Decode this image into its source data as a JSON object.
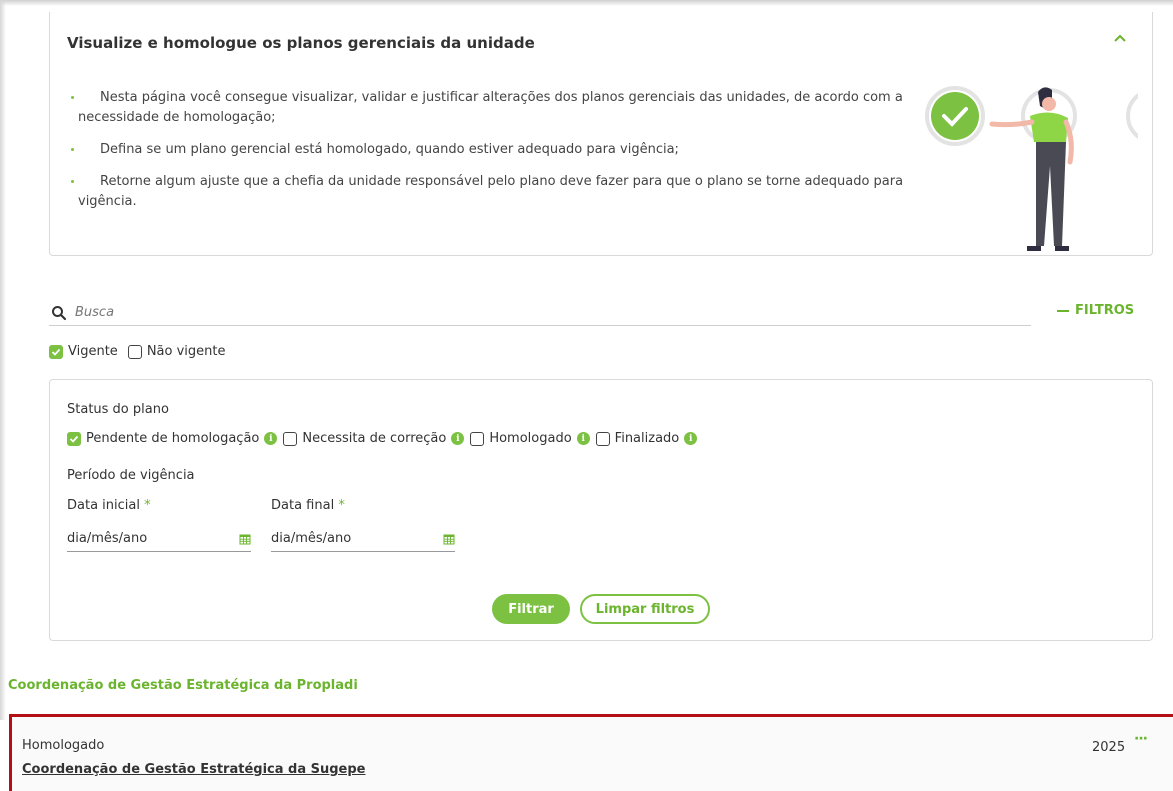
{
  "info": {
    "title": "Visualize e homologue os planos gerenciais da unidade",
    "items": [
      "Nesta página você consegue visualizar, validar e justificar alterações dos planos gerenciais das unidades, de acordo com a necessidade de homologação;",
      "Defina se um plano gerencial está homologado, quando estiver adequado para vigência;",
      "Retorne algum ajuste que a chefia da unidade responsável pelo plano deve fazer para que o plano se torne adequado para vigência."
    ]
  },
  "search": {
    "placeholder": "Busca",
    "filters_label": "FILTROS"
  },
  "vigencia": {
    "vigente": "Vigente",
    "nao_vigente": "Não vigente"
  },
  "filters": {
    "status_title": "Status do plano",
    "status_options": [
      "Pendente de homologação",
      "Necessita de correção",
      "Homologado",
      "Finalizado"
    ],
    "period_title": "Período de vigência",
    "start_label": "Data inicial",
    "end_label": "Data final",
    "required_mark": "*",
    "date_placeholder": "dia/mês/ano",
    "filter_button": "Filtrar",
    "clear_button": "Limpar filtros"
  },
  "section": {
    "title": "Coordenação de Gestão Estratégica da Propladi"
  },
  "result": {
    "status": "Homologado",
    "unit": "Coordenação de Gestão Estratégica da Sugepe",
    "year": "2025",
    "more": "···"
  },
  "colors": {
    "accent": "#7cc142",
    "accent_text": "#6ab42e",
    "highlight_border": "#b30f14"
  },
  "icons": {
    "search": "search-icon",
    "collapse": "chevron-up-icon",
    "calendar": "calendar-icon",
    "info": "info-icon",
    "check": "check-icon"
  }
}
